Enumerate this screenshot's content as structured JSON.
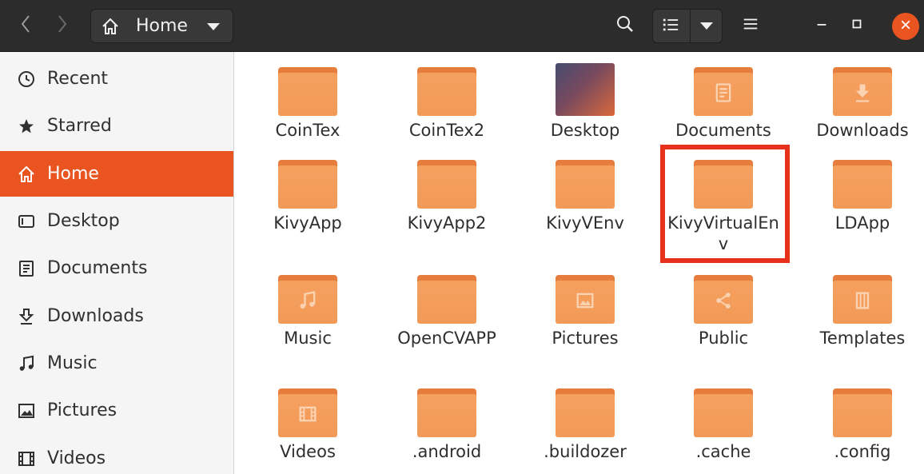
{
  "header": {
    "path_label": "Home"
  },
  "icons": {
    "back": "chevron-left-icon",
    "forward": "chevron-right-icon",
    "home": "home-icon",
    "search": "search-icon",
    "view": "list-view-icon",
    "menu": "hamburger-menu-icon",
    "minimize": "minimize-icon",
    "maximize": "maximize-icon",
    "close": "close-icon"
  },
  "colors": {
    "accent": "#e95420",
    "headerbar": "#2c2c2c",
    "folder": "#f29a58",
    "highlight": "#e8311b"
  },
  "sidebar": {
    "items": [
      {
        "label": "Recent",
        "icon": "clock-icon"
      },
      {
        "label": "Starred",
        "icon": "star-icon"
      },
      {
        "label": "Home",
        "icon": "home-icon",
        "active": true
      },
      {
        "label": "Desktop",
        "icon": "desktop-icon"
      },
      {
        "label": "Documents",
        "icon": "document-icon"
      },
      {
        "label": "Downloads",
        "icon": "download-icon"
      },
      {
        "label": "Music",
        "icon": "music-icon"
      },
      {
        "label": "Pictures",
        "icon": "picture-icon"
      },
      {
        "label": "Videos",
        "icon": "video-icon"
      }
    ]
  },
  "files": [
    {
      "name": "CoinTex"
    },
    {
      "name": "CoinTex2"
    },
    {
      "name": "Desktop"
    },
    {
      "name": "Documents"
    },
    {
      "name": "Downloads"
    },
    {
      "name": "KivyApp"
    },
    {
      "name": "KivyApp2"
    },
    {
      "name": "KivyVEnv"
    },
    {
      "name": "KivyVirtualEnv",
      "highlighted": true
    },
    {
      "name": "LDApp"
    },
    {
      "name": "Music"
    },
    {
      "name": "OpenCVAPP"
    },
    {
      "name": "Pictures"
    },
    {
      "name": "Public"
    },
    {
      "name": "Templates"
    },
    {
      "name": "Videos"
    },
    {
      "name": ".android"
    },
    {
      "name": ".buildozer"
    },
    {
      "name": ".cache"
    },
    {
      "name": ".config"
    }
  ]
}
